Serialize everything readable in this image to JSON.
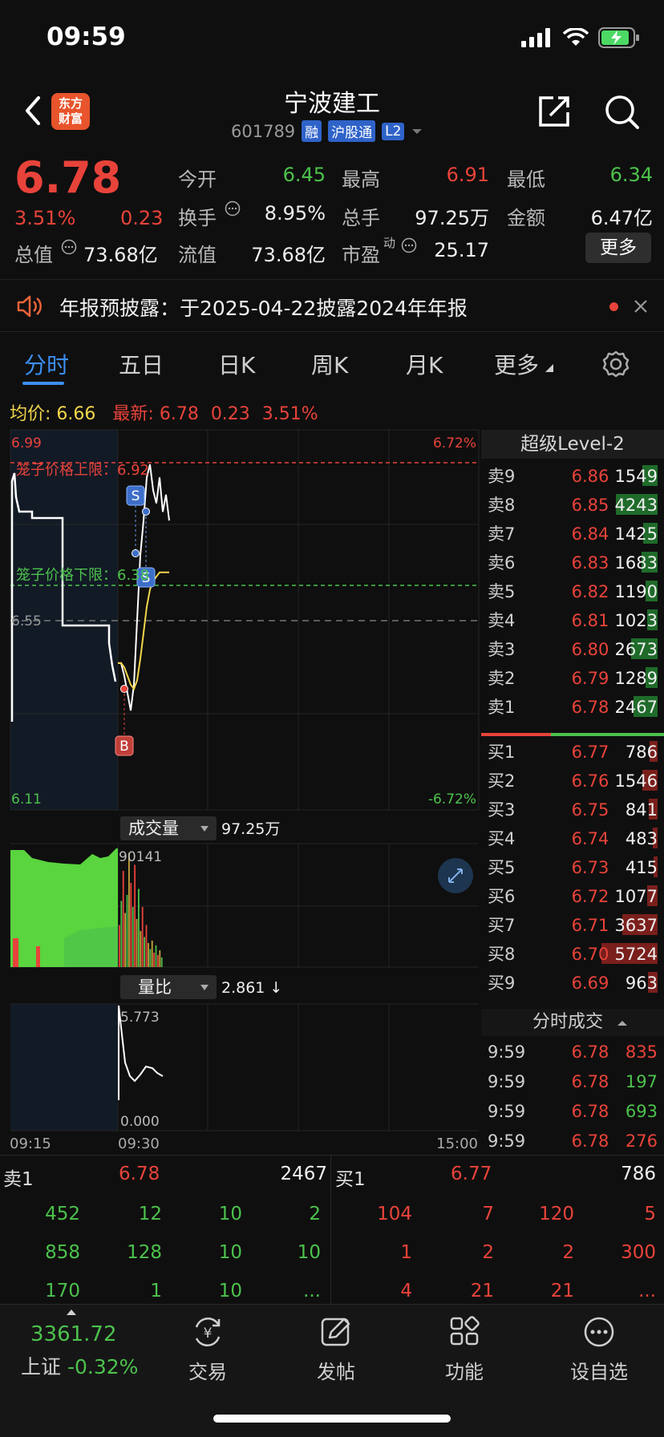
{
  "status": {
    "time": "09:59"
  },
  "header": {
    "logo": [
      "东方",
      "财富"
    ],
    "title": "宁波建工",
    "code": "601789",
    "tags": [
      "融",
      "沪股通",
      "L2"
    ]
  },
  "quote": {
    "price": "6.78",
    "change_pct": "3.51%",
    "change": "0.23",
    "market_cap_label": "总值",
    "market_cap": "73.68亿",
    "open_label": "今开",
    "open": "6.45",
    "high_label": "最高",
    "high": "6.91",
    "low_label": "最低",
    "low": "6.34",
    "turnover_label": "换手",
    "turnover": "8.95%",
    "volume_label": "总手",
    "volume": "97.25万",
    "amount_label": "金额",
    "amount": "6.47亿",
    "float_label": "流值",
    "float": "73.68亿",
    "pe_label": "市盈",
    "pe_sup": "动",
    "pe": "25.17",
    "more": "更多"
  },
  "notice": {
    "text": "年报预披露：于2025-04-22披露2024年年报"
  },
  "tabs": [
    "分时",
    "五日",
    "日K",
    "周K",
    "月K",
    "更多"
  ],
  "chart": {
    "avg_label": "均价:",
    "avg": "6.66",
    "latest_label": "最新:",
    "latest": "6.78",
    "latest_change": "0.23",
    "latest_pct": "3.51%",
    "top_price": "6.99",
    "top_pct": "6.72%",
    "mid_price": "6.55",
    "bottom_price": "6.11",
    "bottom_pct": "-6.72%",
    "cage_upper_label": "笼子价格上限：6.92",
    "cage_lower_label": "笼子价格下限：6.38",
    "marker_s": "S",
    "marker_b": "B",
    "vol_selector": "成交量",
    "vol_total": "97.25万",
    "vol_max": "90141",
    "ratio_selector": "量比",
    "ratio_value": "2.861 ↓",
    "ratio_max": "5.773",
    "ratio_min": "0.000",
    "time_start": "09:15",
    "time_mid": "09:30",
    "time_end": "15:00"
  },
  "chart_data": {
    "type": "line",
    "x": [
      "09:25",
      "09:30",
      "09:31",
      "09:33",
      "09:35",
      "09:37",
      "09:39",
      "09:41",
      "09:43",
      "09:45",
      "09:47",
      "09:49",
      "09:51",
      "09:53",
      "09:55",
      "09:57",
      "09:59"
    ],
    "series": [
      {
        "name": "最新",
        "values": [
          6.45,
          6.45,
          6.42,
          6.38,
          6.34,
          6.4,
          6.55,
          6.7,
          6.78,
          6.88,
          6.91,
          6.85,
          6.82,
          6.88,
          6.8,
          6.84,
          6.78
        ]
      },
      {
        "name": "均价",
        "values": [
          6.45,
          6.45,
          6.44,
          6.42,
          6.4,
          6.39,
          6.41,
          6.46,
          6.52,
          6.58,
          6.62,
          6.64,
          6.65,
          6.66,
          6.66,
          6.66,
          6.66
        ]
      }
    ],
    "ylim": [
      6.11,
      6.99
    ],
    "yclose": 6.55
  },
  "level2": {
    "title": "超级Level-2",
    "asks": [
      {
        "label": "卖9",
        "price": "6.86",
        "vol": "1549",
        "bar": 0.27
      },
      {
        "label": "卖8",
        "price": "6.85",
        "vol": "4243",
        "bar": 0.74
      },
      {
        "label": "卖7",
        "price": "6.84",
        "vol": "1425",
        "bar": 0.25
      },
      {
        "label": "卖6",
        "price": "6.83",
        "vol": "1683",
        "bar": 0.29
      },
      {
        "label": "卖5",
        "price": "6.82",
        "vol": "1190",
        "bar": 0.21
      },
      {
        "label": "卖4",
        "price": "6.81",
        "vol": "1023",
        "bar": 0.18
      },
      {
        "label": "卖3",
        "price": "6.80",
        "vol": "2673",
        "bar": 0.47
      },
      {
        "label": "卖2",
        "price": "6.79",
        "vol": "1289",
        "bar": 0.22
      },
      {
        "label": "卖1",
        "price": "6.78",
        "vol": "2467",
        "bar": 0.43
      }
    ],
    "bids": [
      {
        "label": "买1",
        "price": "6.77",
        "vol": "786",
        "bar": 0.14
      },
      {
        "label": "买2",
        "price": "6.76",
        "vol": "1546",
        "bar": 0.27
      },
      {
        "label": "买3",
        "price": "6.75",
        "vol": "841",
        "bar": 0.15
      },
      {
        "label": "买4",
        "price": "6.74",
        "vol": "483",
        "bar": 0.08
      },
      {
        "label": "买5",
        "price": "6.73",
        "vol": "415",
        "bar": 0.07
      },
      {
        "label": "买6",
        "price": "6.72",
        "vol": "1077",
        "bar": 0.19
      },
      {
        "label": "买7",
        "price": "6.71",
        "vol": "3637",
        "bar": 0.63
      },
      {
        "label": "买8",
        "price": "6.70",
        "vol": "5724",
        "bar": 1.0
      },
      {
        "label": "买9",
        "price": "6.69",
        "vol": "963",
        "bar": 0.17
      }
    ],
    "ticks_title": "分时成交",
    "ticks": [
      {
        "time": "9:59",
        "price": "6.78",
        "vol": "835",
        "dir": "sell"
      },
      {
        "time": "9:59",
        "price": "6.78",
        "vol": "197",
        "dir": "buy"
      },
      {
        "time": "9:59",
        "price": "6.78",
        "vol": "693",
        "dir": "buy"
      },
      {
        "time": "9:59",
        "price": "6.78",
        "vol": "276",
        "dir": "sell"
      }
    ]
  },
  "queue": {
    "sell_label": "卖1",
    "sell_price": "6.78",
    "sell_vol": "2467",
    "buy_label": "买1",
    "buy_price": "6.77",
    "buy_vol": "786",
    "sell_rows": [
      [
        "452",
        "12",
        "10",
        "2"
      ],
      [
        "858",
        "128",
        "10",
        "10"
      ],
      [
        "170",
        "1",
        "10",
        "..."
      ]
    ],
    "buy_rows": [
      [
        "104",
        "7",
        "120",
        "5"
      ],
      [
        "1",
        "2",
        "2",
        "300"
      ],
      [
        "4",
        "21",
        "21",
        "..."
      ]
    ]
  },
  "nav": {
    "index_value": "3361.72",
    "index_name": "上证",
    "index_change": "-0.32%",
    "items": [
      "交易",
      "发帖",
      "功能",
      "设自选"
    ],
    "trade_glyph": "¥"
  },
  "colors": {
    "up": "#e8433a",
    "down": "#4cc24c",
    "accent": "#3d8ef0"
  }
}
